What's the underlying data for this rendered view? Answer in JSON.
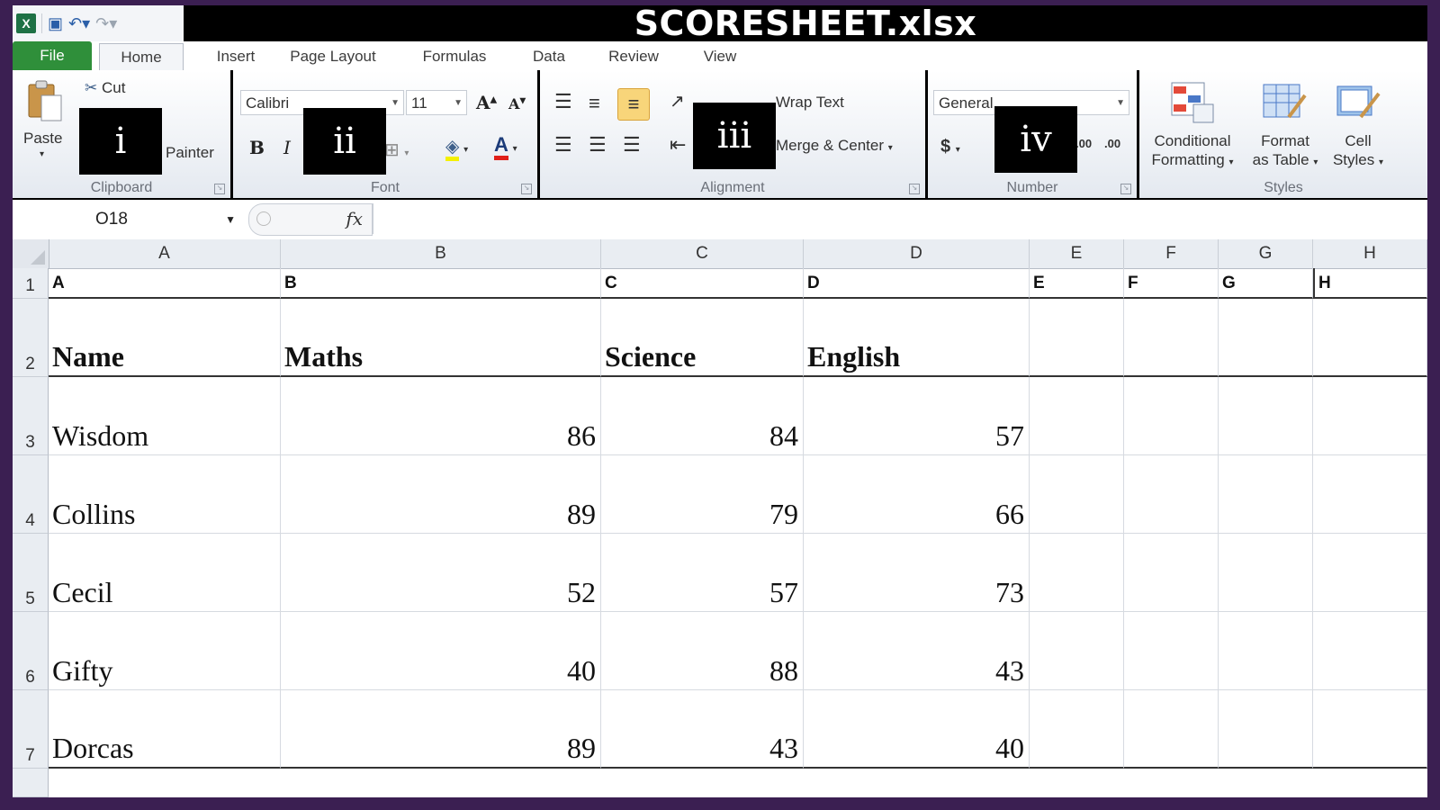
{
  "app": {
    "title": "SCORESHEET.xlsx"
  },
  "quick_access": {
    "icons": [
      "excel-icon",
      "save-icon",
      "undo-icon",
      "redo-icon"
    ]
  },
  "tabs": [
    "File",
    "Home",
    "Insert",
    "Page Layout",
    "Formulas",
    "Data",
    "Review",
    "View"
  ],
  "ribbon": {
    "clipboard": {
      "label": "Clipboard",
      "paste": "Paste",
      "cut": "Cut",
      "painter": "Painter",
      "overlay": "i"
    },
    "font": {
      "label": "Font",
      "font_name": "Calibri",
      "font_size": "11",
      "bold": "B",
      "italic": "I",
      "font_color": "A",
      "grow": "A",
      "shrink": "A",
      "overlay": "ii"
    },
    "alignment": {
      "label": "Alignment",
      "wrap_text": "Wrap Text",
      "merge_center": "Merge & Center",
      "overlay": "iii"
    },
    "number": {
      "label": "Number",
      "format": "General",
      "currency": "$",
      "overlay": "iv",
      "increase_decimal": ".00",
      "decrease_decimal": ".00"
    },
    "styles": {
      "label": "Styles",
      "conditional": [
        "Conditional",
        "Formatting"
      ],
      "format_table": [
        "Format",
        "as Table"
      ],
      "cell_styles": [
        "Cell",
        "Styles"
      ]
    }
  },
  "formula_bar": {
    "name_box": "O18",
    "fx": "fx",
    "formula": ""
  },
  "sheet": {
    "columns": [
      "A",
      "B",
      "C",
      "D",
      "E",
      "F",
      "G",
      "H"
    ],
    "row_numbers": [
      "1",
      "2",
      "3",
      "4",
      "5",
      "6",
      "7"
    ],
    "row1": [
      "A",
      "B",
      "C",
      "D",
      "E",
      "F",
      "G",
      "H"
    ],
    "headers": [
      "Name",
      "Maths",
      "Science",
      "English"
    ],
    "rows": [
      {
        "name": "Wisdom",
        "maths": "86",
        "science": "84",
        "english": "57"
      },
      {
        "name": "Collins",
        "maths": "89",
        "science": "79",
        "english": "66"
      },
      {
        "name": "Cecil",
        "maths": "52",
        "science": "57",
        "english": "73"
      },
      {
        "name": "Gifty",
        "maths": "40",
        "science": "88",
        "english": "43"
      },
      {
        "name": "Dorcas",
        "maths": "89",
        "science": "43",
        "english": "40"
      }
    ]
  },
  "colors": {
    "frame": "#3b1f52",
    "file_tab": "#2f8f3a",
    "title_bar": "#000000"
  }
}
